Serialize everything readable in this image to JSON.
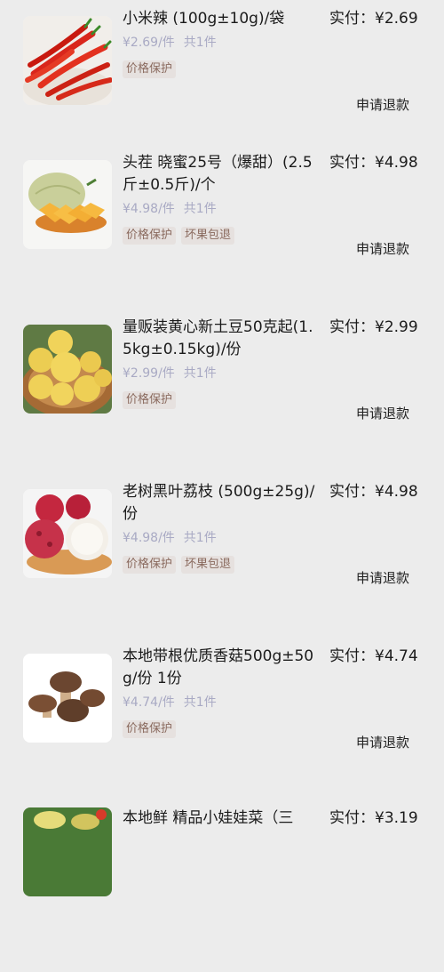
{
  "orders": [
    {
      "title": "小米辣 (100g±10g)/袋",
      "unit_price": "¥2.69/件",
      "qty": "共1件",
      "tags": [
        "价格保护"
      ],
      "pay_label": "实付：",
      "pay_amount": "¥2.69",
      "refund": "申请退款",
      "image": "red-chili-peppers"
    },
    {
      "title": "头茬 晓蜜25号（爆甜）(2.5斤±0.5斤)/个",
      "unit_price": "¥4.98/件",
      "qty": "共1件",
      "tags": [
        "价格保护",
        "坏果包退"
      ],
      "pay_label": "实付：",
      "pay_amount": "¥4.98",
      "refund": "申请退款",
      "image": "hami-melon"
    },
    {
      "title": "量贩装黄心新土豆50克起(1.5kg±0.15kg)/份",
      "unit_price": "¥2.99/件",
      "qty": "共1件",
      "tags": [
        "价格保护"
      ],
      "pay_label": "实付：",
      "pay_amount": "¥2.99",
      "refund": "申请退款",
      "image": "yellow-potatoes"
    },
    {
      "title": "老树黑叶荔枝 (500g±25g)/份",
      "unit_price": "¥4.98/件",
      "qty": "共1件",
      "tags": [
        "价格保护",
        "坏果包退"
      ],
      "pay_label": "实付：",
      "pay_amount": "¥4.98",
      "refund": "申请退款",
      "image": "lychee"
    },
    {
      "title": "本地带根优质香菇500g±50g/份 1份",
      "unit_price": "¥4.74/件",
      "qty": "共1件",
      "tags": [
        "价格保护"
      ],
      "pay_label": "实付：",
      "pay_amount": "¥4.74",
      "refund": "申请退款",
      "image": "shiitake-mushrooms"
    },
    {
      "title": "本地鲜 精品小娃娃菜（三",
      "pay_label": "实付：",
      "pay_amount": "¥3.19",
      "image": "baby-cabbage"
    }
  ]
}
